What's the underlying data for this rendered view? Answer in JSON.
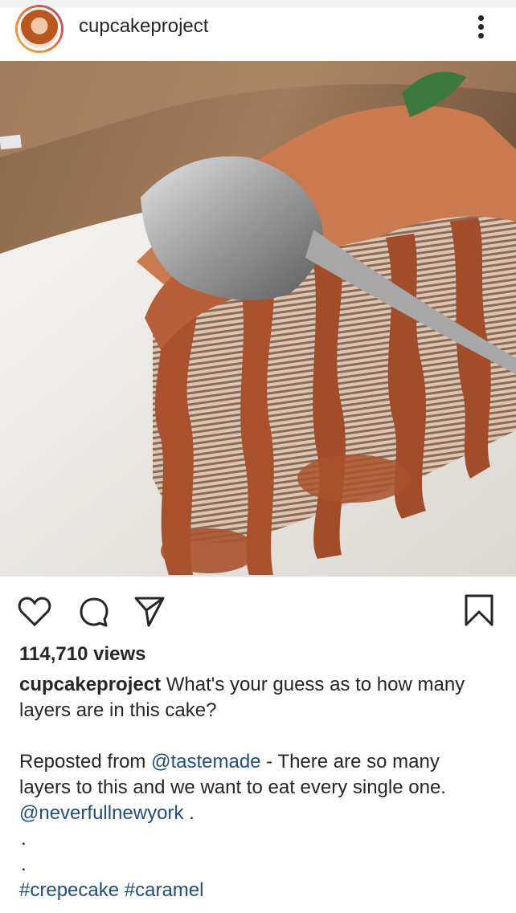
{
  "post": {
    "username": "cupcakeproject",
    "views": "114,710 views",
    "caption": {
      "username": "cupcakeproject",
      "text_line1": "What's your guess as to how many",
      "text_line2": "layers are in this cake?"
    },
    "repost": {
      "prefix": "Reposted from ",
      "mention": "@tastemade",
      "text_after": " -  There are so many",
      "line2": "layers to this and we want to eat every single one.",
      "mention2": "@neverfullnewyork",
      "mention2_suffix": " .",
      "dot1": ".",
      "dot2": ".",
      "hashtag1": "#crepecake",
      "hashtag2": "#caramel"
    }
  },
  "icons": {
    "more": "more-vertical-icon",
    "like": "heart-icon",
    "comment": "comment-icon",
    "share": "send-icon",
    "save": "bookmark-icon",
    "tag": "user-tag-icon"
  }
}
